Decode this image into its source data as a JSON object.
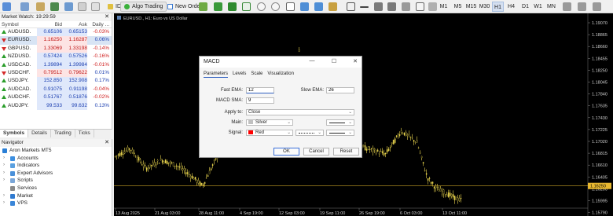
{
  "toolbar": {
    "ide_label": "IDE",
    "algo_trading_label": "Algo Trading",
    "new_order_label": "New Order",
    "timeframes": [
      "M1",
      "M5",
      "M15",
      "M30",
      "H1",
      "H4",
      "D1",
      "W1",
      "MN"
    ],
    "active_timeframe": "H1"
  },
  "market_watch": {
    "title": "Market Watch: 19:29:59",
    "columns": [
      "Symbol",
      "Bid",
      "Ask",
      "Daily ..."
    ],
    "rows": [
      {
        "symbol": "AUDUSD.",
        "bid": "0.65106",
        "ask": "0.65153",
        "change": "-0.03%",
        "dir": "up"
      },
      {
        "symbol": "EURUSD.",
        "bid": "1.16250",
        "ask": "1.16287",
        "change": "0.06%",
        "dir": "dn"
      },
      {
        "symbol": "GBPUSD.",
        "bid": "1.33069",
        "ask": "1.33198",
        "change": "-0.14%",
        "dir": "dn"
      },
      {
        "symbol": "NZDUSD.",
        "bid": "0.57424",
        "ask": "0.57526",
        "change": "-0.16%",
        "dir": "up"
      },
      {
        "symbol": "USDCAD.",
        "bid": "1.39894",
        "ask": "1.39984",
        "change": "-0.01%",
        "dir": "up"
      },
      {
        "symbol": "USDCHF.",
        "bid": "0.79512",
        "ask": "0.79622",
        "change": "0.01%",
        "dir": "dn"
      },
      {
        "symbol": "USDJPY.",
        "bid": "152.850",
        "ask": "152.908",
        "change": "0.17%",
        "dir": "up"
      },
      {
        "symbol": "AUDCAD.",
        "bid": "0.91075",
        "ask": "0.91198",
        "change": "-0.04%",
        "dir": "up"
      },
      {
        "symbol": "AUDCHF.",
        "bid": "0.51767",
        "ask": "0.51876",
        "change": "-0.02%",
        "dir": "up"
      },
      {
        "symbol": "AUDJPY.",
        "bid": "99.533",
        "ask": "99.632",
        "change": "0.13%",
        "dir": "up"
      }
    ],
    "tabs": [
      "Symbols",
      "Details",
      "Trading",
      "Ticks"
    ],
    "active_tab": "Symbols"
  },
  "navigator": {
    "title": "Navigator",
    "items": [
      {
        "label": "Aron Markets MT5",
        "icon": "broker-icon",
        "color": "#2a7fd6"
      },
      {
        "label": "Accounts",
        "icon": "accounts-icon",
        "color": "#3d8fe0"
      },
      {
        "label": "Indicators",
        "icon": "indicators-icon",
        "color": "#5aa0e0"
      },
      {
        "label": "Expert Advisors",
        "icon": "experts-icon",
        "color": "#4a90d9"
      },
      {
        "label": "Scripts",
        "icon": "scripts-icon",
        "color": "#7aa6d8"
      },
      {
        "label": "Services",
        "icon": "services-icon",
        "color": "#888888"
      },
      {
        "label": "Market",
        "icon": "market-icon",
        "color": "#2f7ad0"
      },
      {
        "label": "VPS",
        "icon": "vps-icon",
        "color": "#3a86d8"
      }
    ]
  },
  "chart": {
    "symbol_label": "EURUSD., H1:  Euro vs US Dollar",
    "current_price": "1.16250",
    "price_labels": [
      "1.19070",
      "1.18865",
      "1.18660",
      "1.18455",
      "1.18250",
      "1.18045",
      "1.17840",
      "1.17635",
      "1.17430",
      "1.17225",
      "1.17020",
      "1.16815",
      "1.16610",
      "1.16405",
      "1.16200",
      "1.15995",
      "1.15790"
    ],
    "time_labels": [
      "13 Aug 2025",
      "21 Aug 03:00",
      "28 Aug 11:00",
      "4 Sep 19:00",
      "12 Sep 03:00",
      "19 Sep 11:00",
      "26 Sep 19:00",
      "6 Oct 03:00",
      "13 Oct 11:00"
    ],
    "colors": {
      "background": "#000000",
      "candles": "#e8d44d",
      "price_line": "#c9a227",
      "price_tag": "#e8b830"
    }
  },
  "dialog": {
    "title": "MACD",
    "tabs": [
      "Parameters",
      "Levels",
      "Scale",
      "Visualization"
    ],
    "active_tab": "Parameters",
    "fast_ema_label": "Fast EMA:",
    "fast_ema_value": "12",
    "slow_ema_label": "Slow EMA:",
    "slow_ema_value": "26",
    "macd_sma_label": "MACD SMA:",
    "macd_sma_value": "9",
    "apply_to_label": "Apply to:",
    "apply_to_value": "Close",
    "main_label": "Main:",
    "main_color_name": "Silver",
    "main_color": "#c0c0c0",
    "signal_label": "Signal:",
    "signal_color_name": "Red",
    "signal_color": "#ff0000",
    "ok_label": "OK",
    "cancel_label": "Cancel",
    "reset_label": "Reset"
  }
}
